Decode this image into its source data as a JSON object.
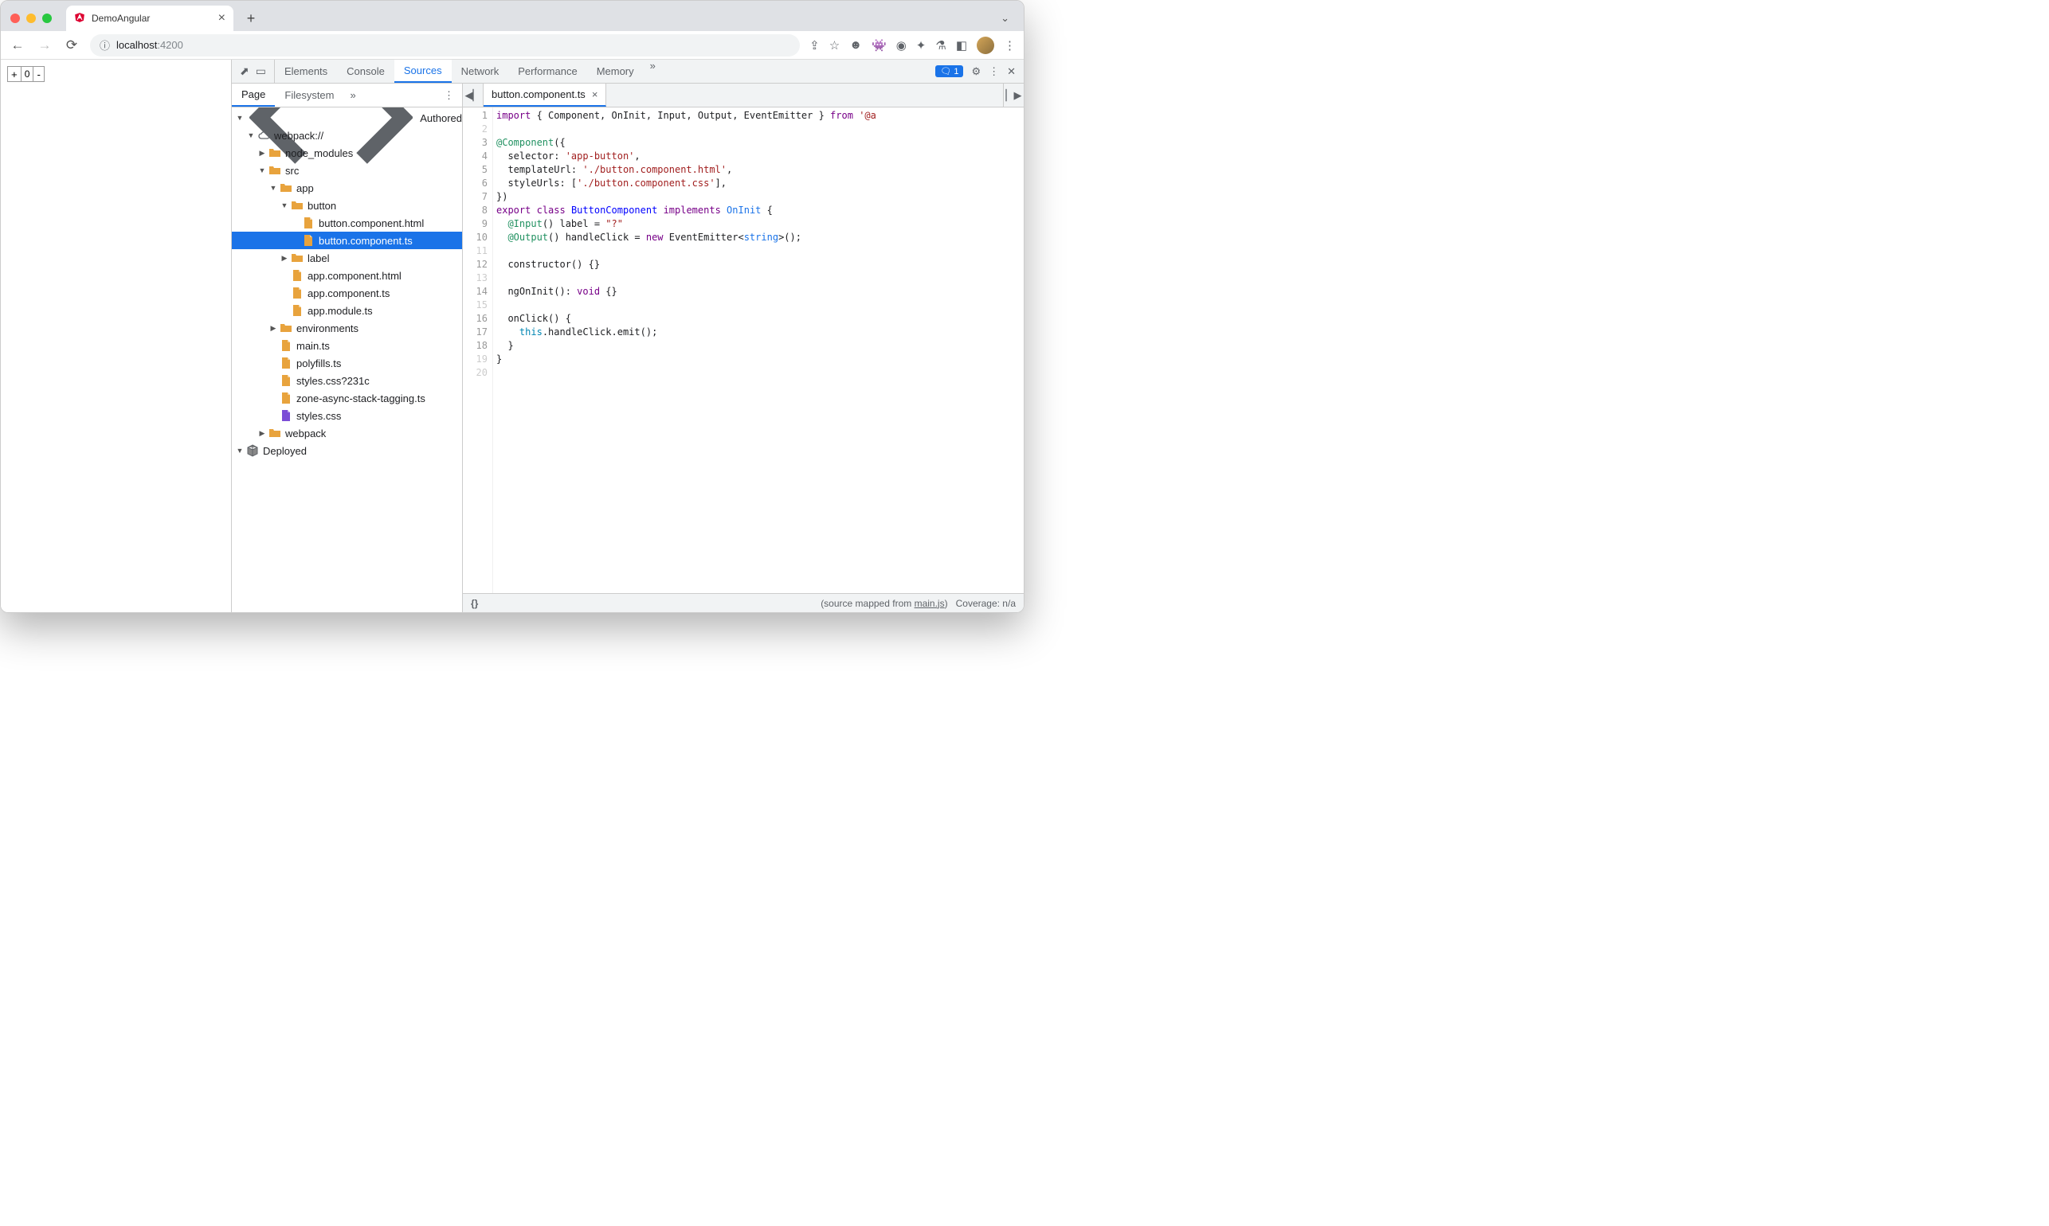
{
  "browser": {
    "tab_title": "DemoAngular",
    "url_host": "localhost",
    "url_port": ":4200",
    "counter_plus": "+",
    "counter_val": "0",
    "counter_minus": "-"
  },
  "devtools": {
    "panels": [
      "Elements",
      "Console",
      "Sources",
      "Network",
      "Performance",
      "Memory"
    ],
    "active_panel": "Sources",
    "issue_count": "1",
    "source_subtabs": [
      "Page",
      "Filesystem"
    ],
    "active_subtab": "Page",
    "open_file": "button.component.ts",
    "status_mapped_prefix": "(source mapped from ",
    "status_mapped_link": "main.js",
    "status_mapped_suffix": ")",
    "status_coverage": "Coverage: n/a"
  },
  "tree": [
    {
      "depth": 0,
      "arrow": "down",
      "icon": "code",
      "label": "Authored"
    },
    {
      "depth": 1,
      "arrow": "down",
      "icon": "cloud",
      "label": "webpack://"
    },
    {
      "depth": 2,
      "arrow": "right",
      "icon": "folder",
      "label": "node_modules"
    },
    {
      "depth": 2,
      "arrow": "down",
      "icon": "folder",
      "label": "src"
    },
    {
      "depth": 3,
      "arrow": "down",
      "icon": "folder",
      "label": "app"
    },
    {
      "depth": 4,
      "arrow": "down",
      "icon": "folder",
      "label": "button"
    },
    {
      "depth": 5,
      "arrow": "",
      "icon": "file-y",
      "label": "button.component.html"
    },
    {
      "depth": 5,
      "arrow": "",
      "icon": "file-y",
      "label": "button.component.ts",
      "selected": true
    },
    {
      "depth": 4,
      "arrow": "right",
      "icon": "folder",
      "label": "label"
    },
    {
      "depth": 4,
      "arrow": "",
      "icon": "file-y",
      "label": "app.component.html"
    },
    {
      "depth": 4,
      "arrow": "",
      "icon": "file-y",
      "label": "app.component.ts"
    },
    {
      "depth": 4,
      "arrow": "",
      "icon": "file-y",
      "label": "app.module.ts"
    },
    {
      "depth": 3,
      "arrow": "right",
      "icon": "folder",
      "label": "environments"
    },
    {
      "depth": 3,
      "arrow": "",
      "icon": "file-y",
      "label": "main.ts"
    },
    {
      "depth": 3,
      "arrow": "",
      "icon": "file-y",
      "label": "polyfills.ts"
    },
    {
      "depth": 3,
      "arrow": "",
      "icon": "file-y",
      "label": "styles.css?231c"
    },
    {
      "depth": 3,
      "arrow": "",
      "icon": "file-y",
      "label": "zone-async-stack-tagging.ts"
    },
    {
      "depth": 3,
      "arrow": "",
      "icon": "file-p",
      "label": "styles.css"
    },
    {
      "depth": 2,
      "arrow": "right",
      "icon": "folder",
      "label": "webpack"
    },
    {
      "depth": 0,
      "arrow": "down",
      "icon": "cube",
      "label": "Deployed"
    }
  ],
  "code_lines": [
    {
      "n": 1,
      "html": "<span class='kw'>import</span> { Component, OnInit, Input, Output, EventEmitter } <span class='kw'>from</span> <span class='str'>'@a</span>"
    },
    {
      "n": 2,
      "html": "",
      "dead": true
    },
    {
      "n": 3,
      "html": "<span class='at'>@Component</span>({"
    },
    {
      "n": 4,
      "html": "  selector: <span class='str'>'app-button'</span>,"
    },
    {
      "n": 5,
      "html": "  templateUrl: <span class='str'>'./button.component.html'</span>,"
    },
    {
      "n": 6,
      "html": "  styleUrls: [<span class='str'>'./button.component.css'</span>],"
    },
    {
      "n": 7,
      "html": "})"
    },
    {
      "n": 8,
      "html": "<span class='kw'>export</span> <span class='kw'>class</span> <span class='cls'>ButtonComponent</span> <span class='impl'>implements</span> <span class='type'>OnInit</span> {"
    },
    {
      "n": 9,
      "html": "  <span class='at'>@Input</span>() label = <span class='str'>\"?\"</span>"
    },
    {
      "n": 10,
      "html": "  <span class='at'>@Output</span>() handleClick = <span class='new'>new</span> EventEmitter&lt;<span class='type'>string</span>&gt;();"
    },
    {
      "n": 11,
      "html": "",
      "dead": true
    },
    {
      "n": 12,
      "html": "  constructor() {}"
    },
    {
      "n": 13,
      "html": "",
      "dead": true
    },
    {
      "n": 14,
      "html": "  ngOnInit(): <span class='void'>void</span> {}"
    },
    {
      "n": 15,
      "html": "",
      "dead": true
    },
    {
      "n": 16,
      "html": "  onClick() {"
    },
    {
      "n": 17,
      "html": "    <span class='this'>this</span>.handleClick.emit();"
    },
    {
      "n": 18,
      "html": "  }"
    },
    {
      "n": 19,
      "html": "}",
      "dead": true
    },
    {
      "n": 20,
      "html": "",
      "dead": true
    }
  ]
}
